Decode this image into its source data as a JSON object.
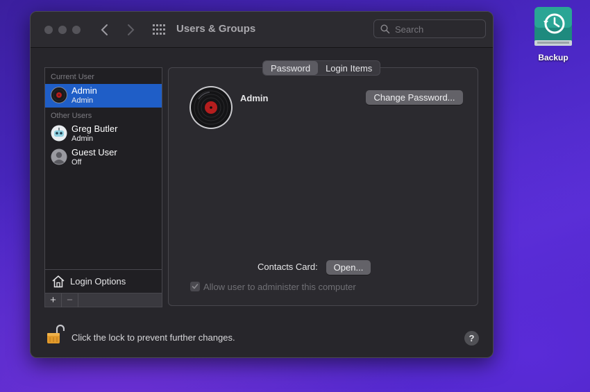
{
  "window": {
    "title": "Users & Groups",
    "search": {
      "placeholder": "Search",
      "value": ""
    }
  },
  "sidebar": {
    "current_user_header": "Current User",
    "other_users_header": "Other Users",
    "current_user": {
      "name": "Admin",
      "role": "Admin"
    },
    "other_users": [
      {
        "name": "Greg Butler",
        "role": "Admin"
      },
      {
        "name": "Guest User",
        "role": "Off"
      }
    ],
    "login_options_label": "Login Options",
    "add_label": "+",
    "remove_label": "−"
  },
  "tabs": [
    {
      "label": "Password",
      "active": true
    },
    {
      "label": "Login Items",
      "active": false
    }
  ],
  "detail": {
    "account_name": "Admin",
    "change_password_label": "Change Password...",
    "contacts_card_label": "Contacts Card:",
    "open_label": "Open...",
    "allow_admin_label": "Allow user to administer this computer",
    "allow_admin_checked": true
  },
  "footer": {
    "lock_text": "Click the lock to prevent further changes.",
    "help_label": "?"
  },
  "desktop": {
    "backup_label": "Backup"
  },
  "colors": {
    "selection": "#1f5ec7",
    "window_bg": "#27262b",
    "desktop_bg": "#4a27c4"
  }
}
